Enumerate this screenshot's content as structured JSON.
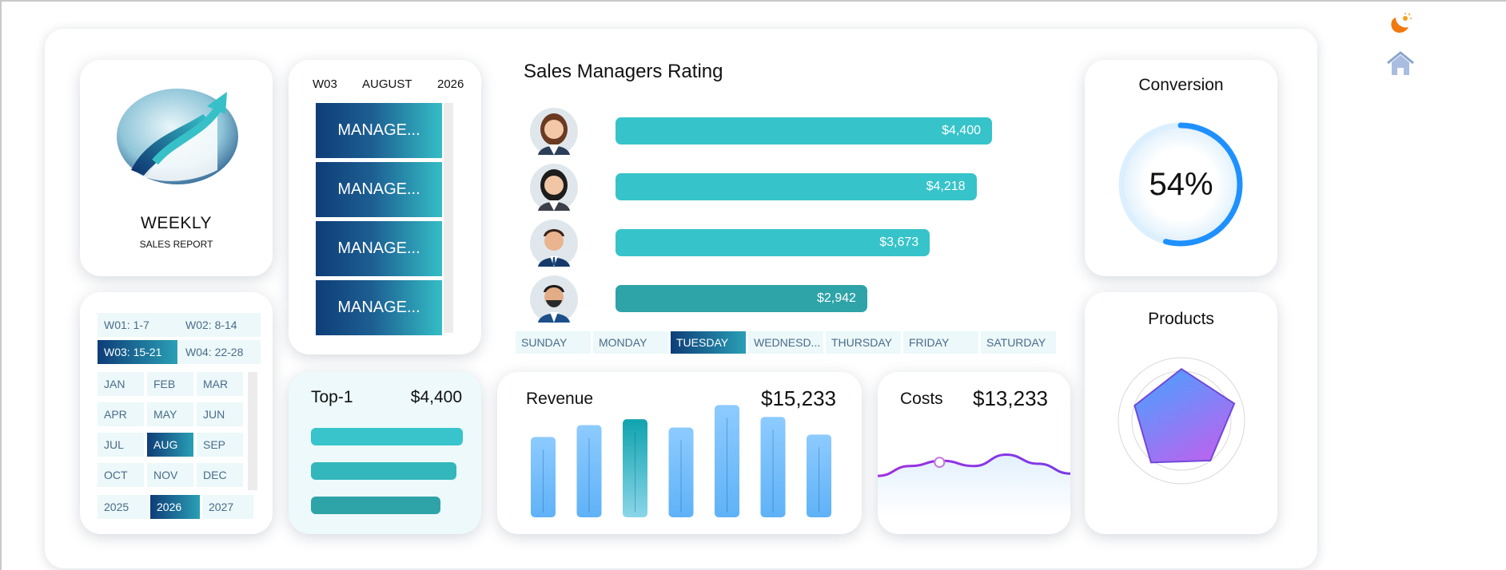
{
  "logo": {
    "title": "WEEKLY",
    "subtitle": "SALES REPORT"
  },
  "period": {
    "week": "W03",
    "month": "AUGUST",
    "year": "2026"
  },
  "managers": [
    "MANAGE...",
    "MANAGE...",
    "MANAGE...",
    "MANAGE..."
  ],
  "rating": {
    "title": "Sales Managers Rating",
    "rows": [
      {
        "label": "$4,400",
        "value": 4400
      },
      {
        "label": "$4,218",
        "value": 4218
      },
      {
        "label": "$3,673",
        "value": 3673
      },
      {
        "label": "$2,942",
        "value": 2942
      }
    ]
  },
  "days": [
    "SUNDAY",
    "MONDAY",
    "TUESDAY",
    "WEDNESD...",
    "THURSDAY",
    "FRIDAY",
    "SATURDAY"
  ],
  "active_day": "TUESDAY",
  "conversion": {
    "title": "Conversion",
    "value_label": "54%",
    "fraction": 0.54
  },
  "products": {
    "title": "Products",
    "values": [
      0.82,
      0.88,
      0.78,
      0.82,
      0.78
    ]
  },
  "calendar": {
    "weeks": [
      "W01: 1-7",
      "W02: 8-14",
      "W03: 15-21",
      "W04: 22-28"
    ],
    "active_week": "W03: 15-21",
    "months": [
      "JAN",
      "FEB",
      "MAR",
      "APR",
      "MAY",
      "JUN",
      "JUL",
      "AUG",
      "SEP",
      "OCT",
      "NOV",
      "DEC"
    ],
    "active_month": "AUG",
    "years": [
      "2025",
      "2026",
      "2027"
    ],
    "active_year": "2026"
  },
  "top1": {
    "label": "Top-1",
    "value": "$4,400",
    "bars": [
      1.0,
      0.96,
      0.85
    ]
  },
  "revenue": {
    "label": "Revenue",
    "value": "$15,233",
    "bars": [
      0.68,
      0.78,
      0.83,
      0.76,
      0.95,
      0.85,
      0.7
    ],
    "highlight_index": 2
  },
  "costs": {
    "label": "Costs",
    "value": "$13,233",
    "series": [
      0.42,
      0.55,
      0.62,
      0.55,
      0.7,
      0.58,
      0.45
    ]
  },
  "colors": {
    "teal": "#36c3c9",
    "navy": "#0e3d78",
    "blue": "#1e90ff",
    "purple": "#a030e0"
  },
  "icons": [
    "moon-sun-icon",
    "home-icon"
  ]
}
